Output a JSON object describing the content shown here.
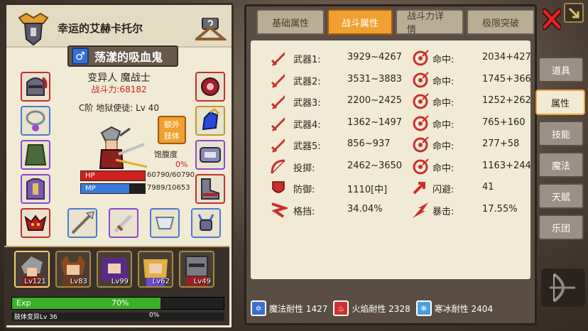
{
  "player": {
    "name": "幸运的艾赫卡托尔",
    "char_title": "荡漾的吸血鬼",
    "gender_symbol": "♂",
    "class_line": "变异人 魔战士",
    "power_line": "战斗力:68182",
    "rank_line": "C阶 地狱使徒: Lv 40",
    "extra_button": "额外\n肢体",
    "satiety_label": "饱腹度",
    "satiety_value": "0%",
    "hp_label": "HP",
    "hp_value": "60790/60790",
    "hp_fraction": 1.0,
    "mp_label": "MP",
    "mp_value": "7989/10653",
    "mp_fraction": 0.75
  },
  "party": [
    {
      "level": "Lv121",
      "active": true
    },
    {
      "level": "Lv83",
      "active": false
    },
    {
      "level": "Lv99",
      "active": false
    },
    {
      "level": "Lv62",
      "active": false
    },
    {
      "level": "Lv49",
      "active": false
    }
  ],
  "exp": {
    "label": "Exp",
    "percent_text": "70%",
    "fraction": 0.7,
    "sub_label": "肢体变异Lv 36",
    "sub_percent": "0%"
  },
  "tabs": [
    "基础属性",
    "战斗属性",
    "战斗力详情",
    "极限突破"
  ],
  "active_tab": 1,
  "stats_left": [
    {
      "label": "武器1:",
      "value": "3929~4267",
      "icon": "sword-icon"
    },
    {
      "label": "武器2:",
      "value": "3531~3883",
      "icon": "sword-icon"
    },
    {
      "label": "武器3:",
      "value": "2200~2425",
      "icon": "sword-icon"
    },
    {
      "label": "武器4:",
      "value": "1362~1497",
      "icon": "sword-icon"
    },
    {
      "label": "武器5:",
      "value": "856~937",
      "icon": "sword-icon"
    },
    {
      "label": "投掷:",
      "value": "2462~3650",
      "icon": "bow-icon"
    },
    {
      "label": "防御:",
      "value": "1110[中]",
      "icon": "shield-icon"
    },
    {
      "label": "格挡:",
      "value": "34.04%",
      "icon": "block-icon"
    }
  ],
  "stats_right": [
    {
      "label": "命中:",
      "value": "2034+427",
      "icon": "target-icon"
    },
    {
      "label": "命中:",
      "value": "1745+366",
      "icon": "target-icon"
    },
    {
      "label": "命中:",
      "value": "1252+262",
      "icon": "target-icon"
    },
    {
      "label": "命中:",
      "value": "765+160",
      "icon": "target-icon"
    },
    {
      "label": "命中:",
      "value": "277+58",
      "icon": "target-icon"
    },
    {
      "label": "命中:",
      "value": "1163+244",
      "icon": "target-icon"
    },
    {
      "label": "闪避:",
      "value": "41",
      "icon": "dodge-icon"
    },
    {
      "label": "暴击:",
      "value": "17.55%",
      "icon": "crit-icon"
    }
  ],
  "resists": [
    {
      "label": "魔法耐性 1427",
      "color": "#3a6fd0",
      "icon": "magic-resist-icon"
    },
    {
      "label": "火焰耐性 2328",
      "color": "#d03030",
      "icon": "fire-resist-icon"
    },
    {
      "label": "寒冰耐性 2404",
      "color": "#4aa0e0",
      "icon": "ice-resist-icon"
    }
  ],
  "side_nav": [
    "道具",
    "属性",
    "技能",
    "魔法",
    "天赋",
    "乐团"
  ],
  "side_active": 1,
  "colors": {
    "accent": "#f0a030",
    "stat_icon": "#c03030",
    "panel_bg": "#f1ead4"
  }
}
